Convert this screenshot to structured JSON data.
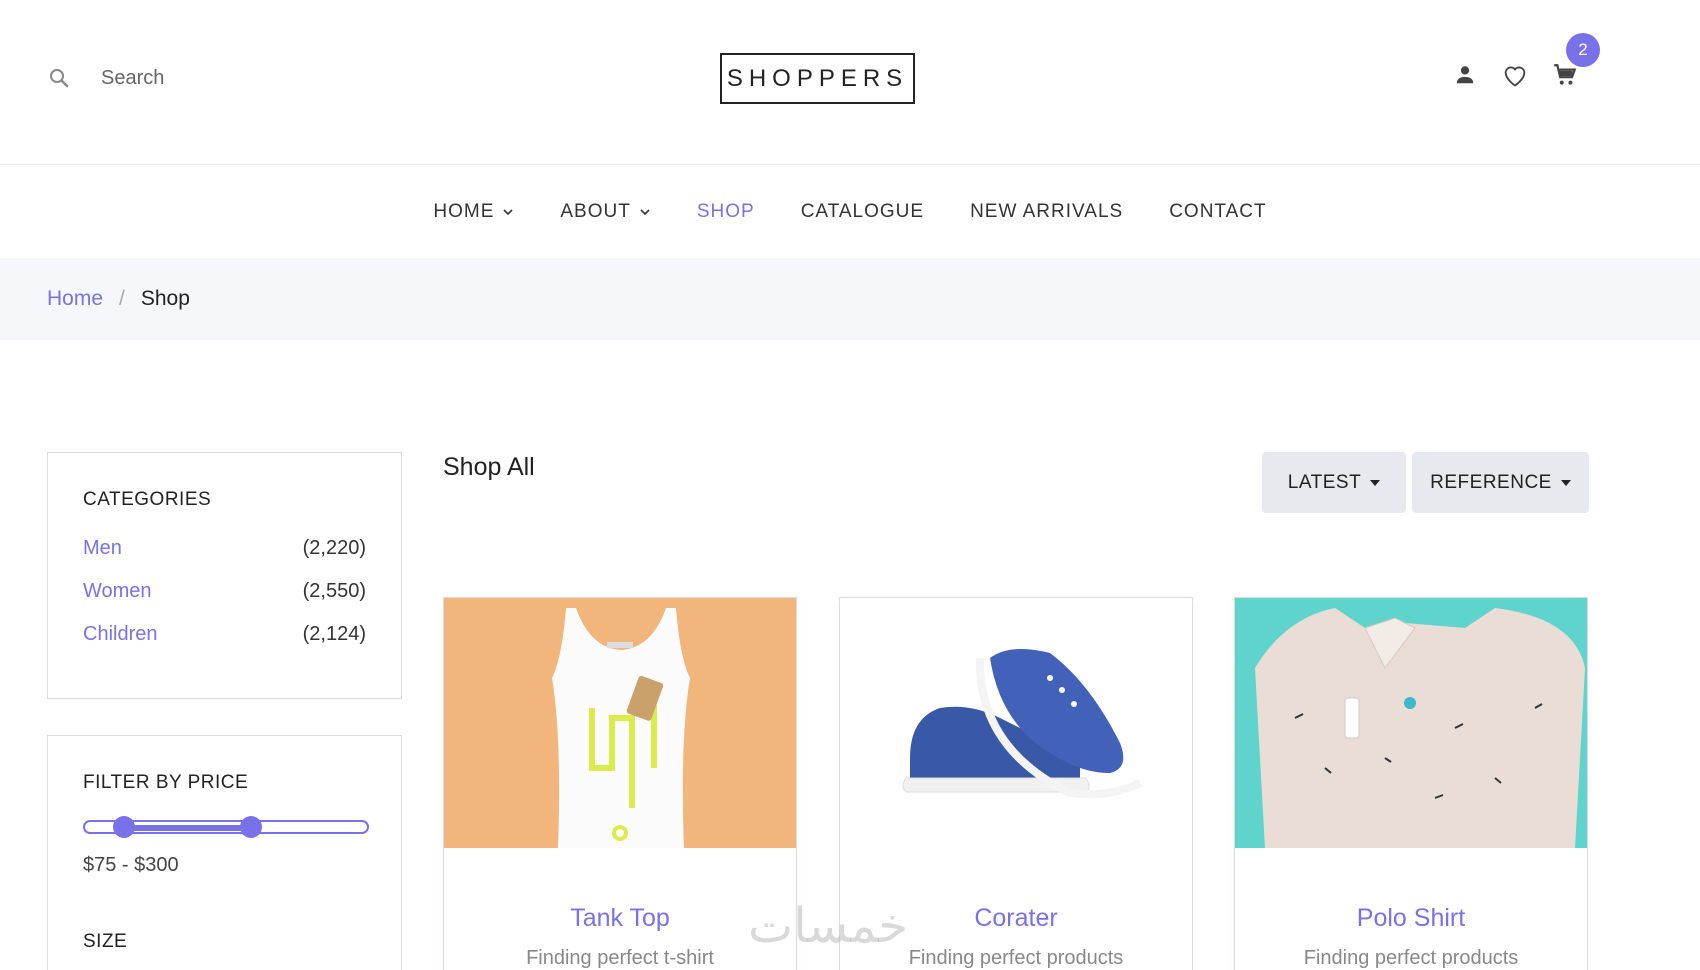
{
  "header": {
    "search_label": "Search",
    "logo_text": "SHOPPERS",
    "cart_count": "2"
  },
  "nav": {
    "items": [
      {
        "label": "HOME",
        "dropdown": true
      },
      {
        "label": "ABOUT",
        "dropdown": true
      },
      {
        "label": "SHOP",
        "active": true
      },
      {
        "label": "CATALOGUE"
      },
      {
        "label": "NEW ARRIVALS"
      },
      {
        "label": "CONTACT"
      }
    ]
  },
  "breadcrumb": {
    "home": "Home",
    "separator": "/",
    "current": "Shop"
  },
  "sidebar": {
    "categories_title": "CATEGORIES",
    "categories": [
      {
        "name": "Men",
        "count": "(2,220)"
      },
      {
        "name": "Women",
        "count": "(2,550)"
      },
      {
        "name": "Children",
        "count": "(2,124)"
      }
    ],
    "price_title": "FILTER BY PRICE",
    "price_range_label": "$75 - $300",
    "price_min_fraction": 0.14,
    "price_max_fraction": 0.59,
    "size_title": "SIZE"
  },
  "main": {
    "title": "Shop All",
    "sort_latest": "LATEST",
    "sort_reference": "REFERENCE"
  },
  "products": [
    {
      "title": "Tank Top",
      "desc": "Finding perfect t-shirt",
      "image": "tank-top-image"
    },
    {
      "title": "Corater",
      "desc": "Finding perfect products",
      "image": "sneaker-image"
    },
    {
      "title": "Polo Shirt",
      "desc": "Finding perfect products",
      "image": "polo-shirt-image"
    }
  ],
  "watermark": "خمسات",
  "colors": {
    "accent": "#7971ea",
    "breadcrumb_bg": "#f6f7fb",
    "tank_bg": "#f2b57b",
    "polo_bg": "#5fd4cc"
  }
}
